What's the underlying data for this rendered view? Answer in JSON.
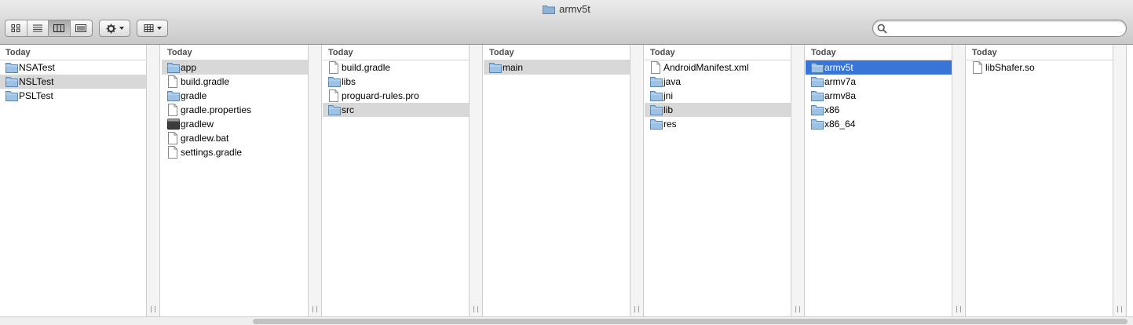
{
  "window": {
    "title": "armv5t"
  },
  "toolbar": {
    "view_buttons": [
      "icon-view",
      "list-view",
      "column-view",
      "coverflow-view"
    ],
    "active_view": "column-view",
    "action_menu": "gear-icon",
    "arrange_menu": "arrange-icon"
  },
  "search": {
    "value": "",
    "placeholder": ""
  },
  "colors": {
    "selection_blue": "#3875d7",
    "selection_gray": "#d8d8d8",
    "folder": "#7fa9cf"
  },
  "columns": [
    {
      "header": "Today",
      "items": [
        {
          "label": "NSATest",
          "kind": "folder"
        },
        {
          "label": "NSLTest",
          "kind": "folder",
          "state": "gray"
        },
        {
          "label": "PSLTest",
          "kind": "folder"
        }
      ]
    },
    {
      "header": "Today",
      "items": [
        {
          "label": "app",
          "kind": "folder",
          "state": "gray"
        },
        {
          "label": "build.gradle",
          "kind": "doc"
        },
        {
          "label": "gradle",
          "kind": "folder"
        },
        {
          "label": "gradle.properties",
          "kind": "doc"
        },
        {
          "label": "gradlew",
          "kind": "exec"
        },
        {
          "label": "gradlew.bat",
          "kind": "doc"
        },
        {
          "label": "settings.gradle",
          "kind": "doc"
        }
      ]
    },
    {
      "header": "Today",
      "items": [
        {
          "label": "build.gradle",
          "kind": "doc"
        },
        {
          "label": "libs",
          "kind": "folder"
        },
        {
          "label": "proguard-rules.pro",
          "kind": "doc"
        },
        {
          "label": "src",
          "kind": "folder",
          "state": "gray"
        }
      ]
    },
    {
      "header": "Today",
      "items": [
        {
          "label": "main",
          "kind": "folder",
          "state": "gray"
        }
      ]
    },
    {
      "header": "Today",
      "items": [
        {
          "label": "AndroidManifest.xml",
          "kind": "doc"
        },
        {
          "label": "java",
          "kind": "folder"
        },
        {
          "label": "jni",
          "kind": "folder"
        },
        {
          "label": "lib",
          "kind": "folder",
          "state": "gray"
        },
        {
          "label": "res",
          "kind": "folder"
        }
      ]
    },
    {
      "header": "Today",
      "items": [
        {
          "label": "armv5t",
          "kind": "folder",
          "state": "blue"
        },
        {
          "label": "armv7a",
          "kind": "folder"
        },
        {
          "label": "armv8a",
          "kind": "folder"
        },
        {
          "label": "x86",
          "kind": "folder"
        },
        {
          "label": "x86_64",
          "kind": "folder"
        }
      ]
    },
    {
      "header": "Today",
      "items": [
        {
          "label": "libShafer.so",
          "kind": "doc"
        }
      ]
    }
  ]
}
